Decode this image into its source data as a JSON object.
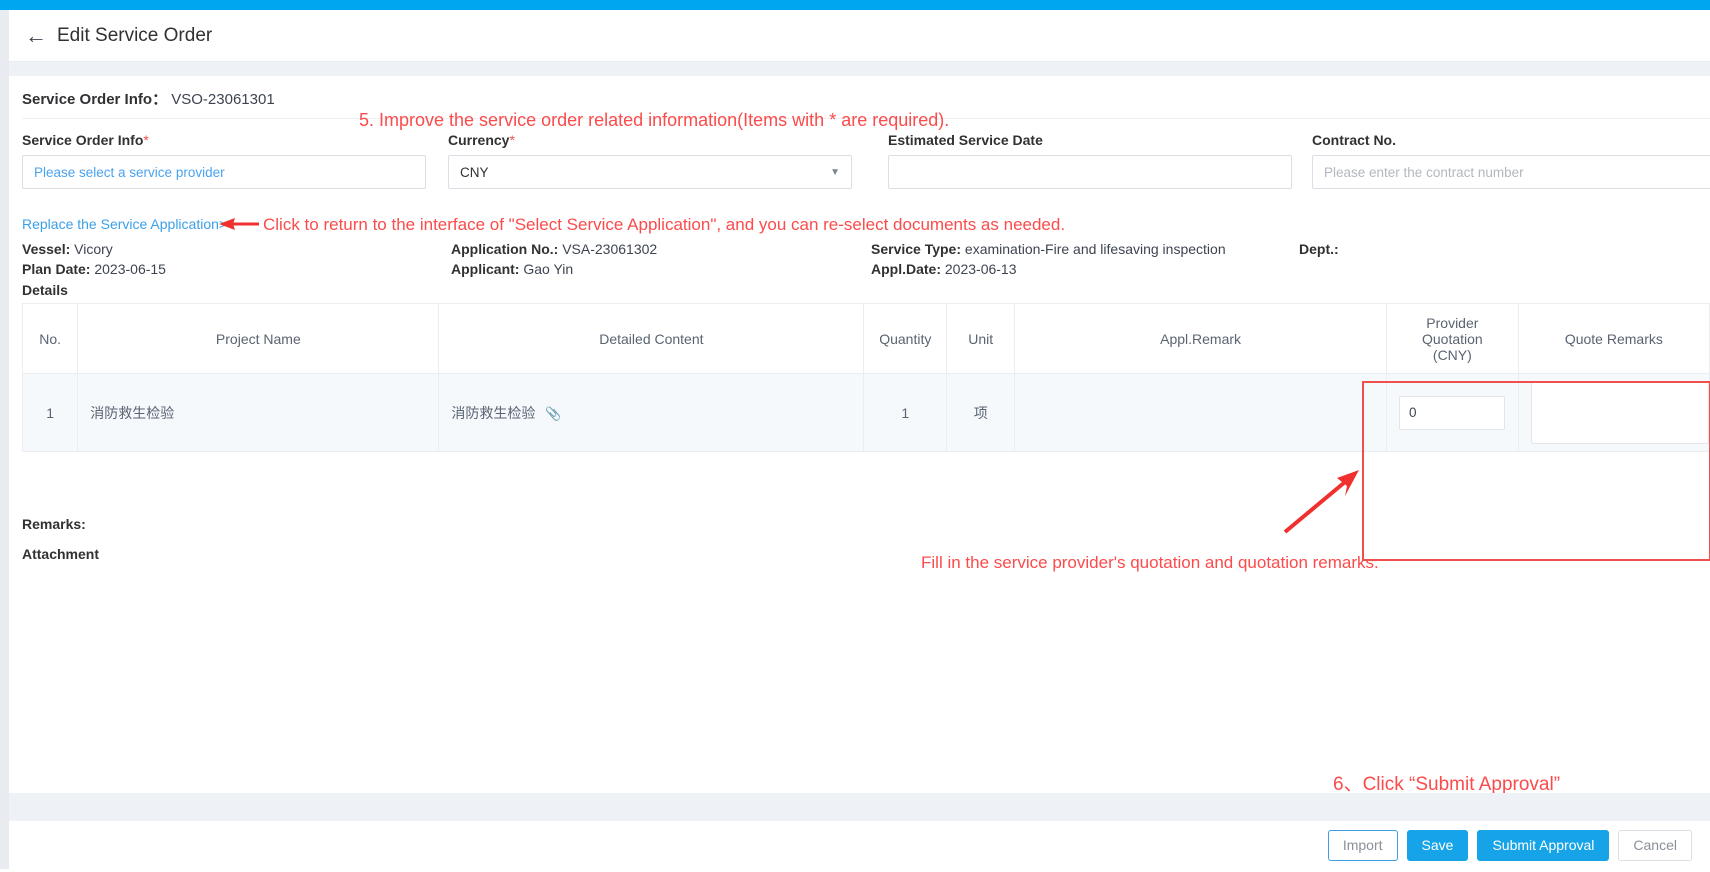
{
  "topbar": {
    "color": "#00a6ef"
  },
  "header": {
    "back_icon": "arrow-left-icon",
    "title": "Edit Service Order"
  },
  "order": {
    "info_label": "Service Order Info",
    "separator": "：",
    "info_value": "VSO-23061301"
  },
  "annotations": {
    "step5": "5. Improve the service order related information(Items with * are required).",
    "replace_hint": "Click to return to the interface of \"Select Service Application\", and you can re-select documents as needed.",
    "quotation_hint": "Fill in the service provider's quotation and quotation remarks.",
    "step6": "6、Click “Submit Approval”",
    "color": "#fb4b4b"
  },
  "form": {
    "fields": [
      {
        "label": "Service Order Info",
        "required": "*",
        "value": "",
        "placeholder": "Please select a service provider",
        "type": "select-link"
      },
      {
        "label": "Currency",
        "required": "*",
        "value": "CNY",
        "placeholder": "",
        "type": "select",
        "caret": "chevron-down-icon"
      },
      {
        "label": "Estimated Service Date",
        "required": "",
        "value": "",
        "placeholder": "",
        "type": "date"
      },
      {
        "label": "Contract No.",
        "required": "",
        "value": "",
        "placeholder": "Please enter the contract number",
        "type": "text"
      }
    ]
  },
  "application": {
    "replace_link": "Replace the Service Application>",
    "meta": [
      {
        "label": "Vessel:",
        "value": "Vicory"
      },
      {
        "label": "Plan Date:",
        "value": "2023-06-15"
      },
      {
        "label": "Application No.:",
        "value": "VSA-23061302"
      },
      {
        "label": "Applicant:",
        "value": "Gao Yin"
      },
      {
        "label": "Service Type:",
        "value": "examination-Fire and lifesaving inspection"
      },
      {
        "label": "Appl.Date:",
        "value": "2023-06-13"
      },
      {
        "label": "Dept.:",
        "value": ""
      }
    ],
    "details_label": "Details"
  },
  "table": {
    "columns": [
      "No.",
      "Project Name",
      "Detailed Content",
      "Quantity",
      "Unit",
      "Appl.Remark",
      "Provider Quotation (CNY)",
      "Quote Remarks"
    ],
    "provider_quotation_header_lines": [
      "Provider",
      "Quotation",
      "(CNY)"
    ],
    "rows": [
      {
        "no": "1",
        "project_name": "消防救生检验",
        "detailed_content": "消防救生检验",
        "attachment_icon": "paperclip-icon",
        "quantity": "1",
        "unit": "项",
        "appl_remark": "",
        "provider_quotation": "0",
        "quote_remarks": ""
      }
    ]
  },
  "bottom": {
    "remarks_label": "Remarks:",
    "attachment_label": "Attachment"
  },
  "footer": {
    "buttons": [
      {
        "label": "Import",
        "style": "outline-blue"
      },
      {
        "label": "Save",
        "style": "solid-blue"
      },
      {
        "label": "Submit Approval",
        "style": "solid-blue"
      },
      {
        "label": "Cancel",
        "style": "outline-gray"
      }
    ]
  }
}
